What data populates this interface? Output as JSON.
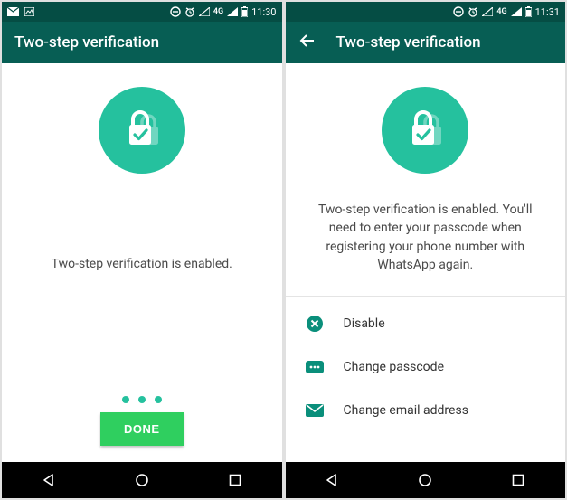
{
  "colors": {
    "primary": "#075e54",
    "primaryDark": "#054d44",
    "accent": "#25c19e",
    "button": "#2fcf5f"
  },
  "left": {
    "statusbar": {
      "network": "4G",
      "time": "11:30"
    },
    "appbar": {
      "title": "Two-step verification"
    },
    "message": "Two-step verification is enabled.",
    "done_label": "DONE"
  },
  "right": {
    "statusbar": {
      "network": "4G",
      "time": "11:31"
    },
    "appbar": {
      "title": "Two-step verification"
    },
    "message": "Two-step verification is enabled. You'll need to enter your passcode when registering your phone number with WhatsApp again.",
    "options": {
      "disable": "Disable",
      "change_passcode": "Change passcode",
      "change_email": "Change email address"
    }
  }
}
